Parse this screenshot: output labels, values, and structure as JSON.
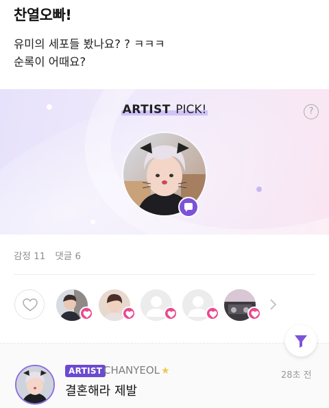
{
  "post": {
    "title": "찬열오빠!",
    "body_lines": [
      "유미의 세포들 봤나요? ? ㅋㅋㅋ",
      "순록이 어때요?"
    ]
  },
  "artist_pick": {
    "title_bold": "ARTIST",
    "title_rest": " PICK!",
    "help_glyph": "?"
  },
  "stats": {
    "emotions": "감정 11",
    "comments": "댓글 6"
  },
  "reactions": {
    "avatars": [
      "user-photo",
      "user-photo",
      "default-avatar",
      "default-avatar",
      "user-photo"
    ],
    "more_glyph": "›"
  },
  "comment": {
    "badge": "ARTIST",
    "author": "CHANYEOL",
    "star": "★",
    "time": "28초 전",
    "text": "결혼해라 제발"
  },
  "colors": {
    "accent_purple": "#6b4ad1",
    "heart_pink": "#e84a8f",
    "badge_purple": "#7c53d8"
  }
}
